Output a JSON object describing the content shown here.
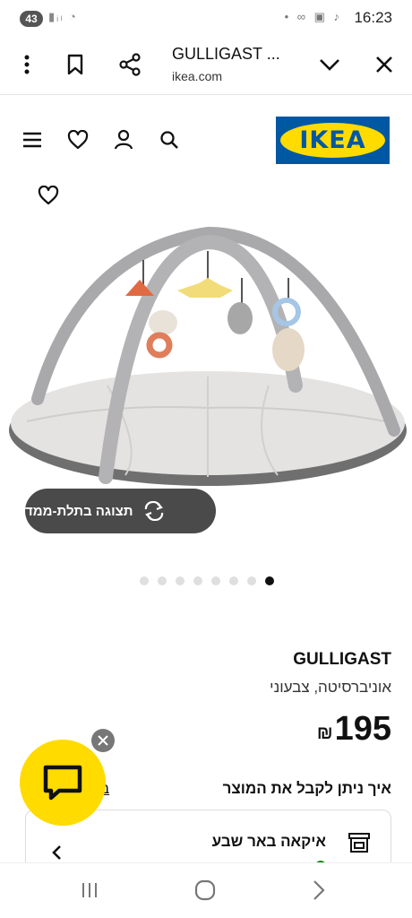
{
  "status_bar": {
    "notification_count": "43",
    "time": "16:23"
  },
  "browser": {
    "page_title": "GULLIGAST ...",
    "url": "ikea.com",
    "icons": [
      "more-vert-icon",
      "bookmark-icon",
      "share-icon",
      "chevron-down-icon",
      "close-icon"
    ]
  },
  "header": {
    "logo_text": "IKEA",
    "icons": [
      "menu-icon",
      "heart-icon",
      "user-icon",
      "search-icon"
    ]
  },
  "gallery": {
    "view_3d_label": "תצוגה בתלת-ממד",
    "dots_total": 8,
    "active_dot": 8
  },
  "product": {
    "name": "GULLIGAST",
    "description": "אוניברסיטה, צבעוני",
    "price": "195",
    "currency": "₪",
    "how_to_get": "איך ניתן לקבל את המוצר",
    "link_text": "ב",
    "store_name": "איקאה באר שבע"
  },
  "colors": {
    "ikea_blue": "#0058a3",
    "ikea_yellow": "#ffdb00",
    "pill_dark": "#4a4a4a"
  }
}
